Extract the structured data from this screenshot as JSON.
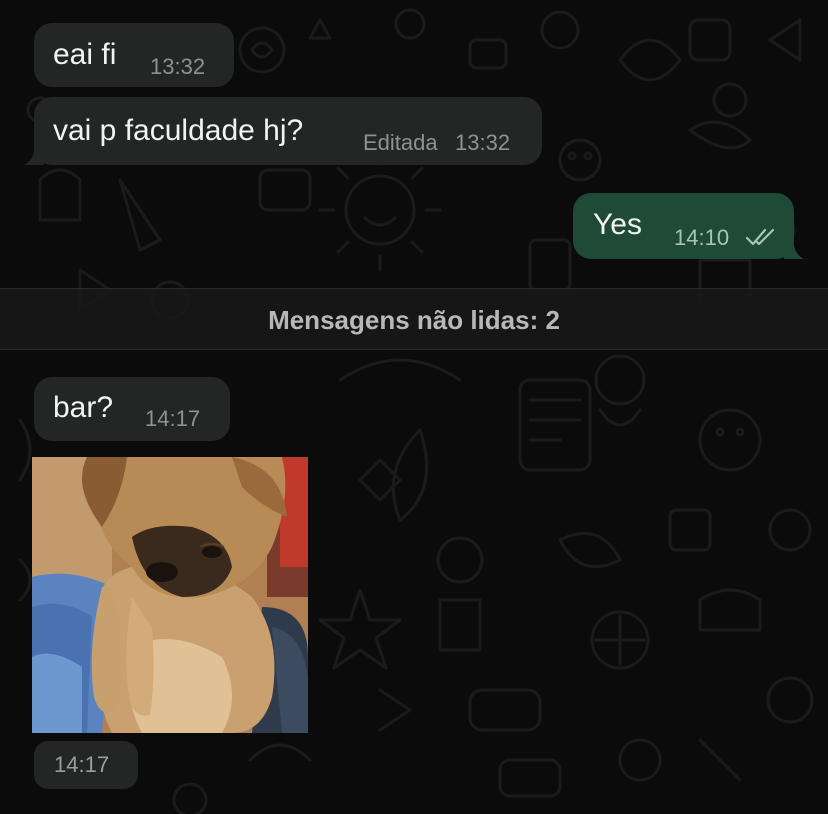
{
  "chat": {
    "messages": [
      {
        "direction": "incoming",
        "text": "eai fi",
        "time": "13:32"
      },
      {
        "direction": "incoming",
        "text": "vai p faculdade hj?",
        "edited_label": "Editada",
        "time": "13:32"
      },
      {
        "direction": "outgoing",
        "text": "Yes",
        "time": "14:10",
        "status_icon": "double-check-icon"
      },
      {
        "direction": "incoming",
        "text": "bar?",
        "time": "14:17"
      },
      {
        "direction": "incoming",
        "type": "sticker",
        "sticker_icon": "puppy-sticker",
        "time": "14:17"
      }
    ],
    "unread_banner": "Mensagens não lidas: 2"
  },
  "colors": {
    "background": "#0b0b0b",
    "incoming_bubble": "#242626",
    "outgoing_bubble": "#1e4a36",
    "text": "#f3f3f3",
    "meta": "#8e9292",
    "banner_text": "#b8b8b8"
  }
}
